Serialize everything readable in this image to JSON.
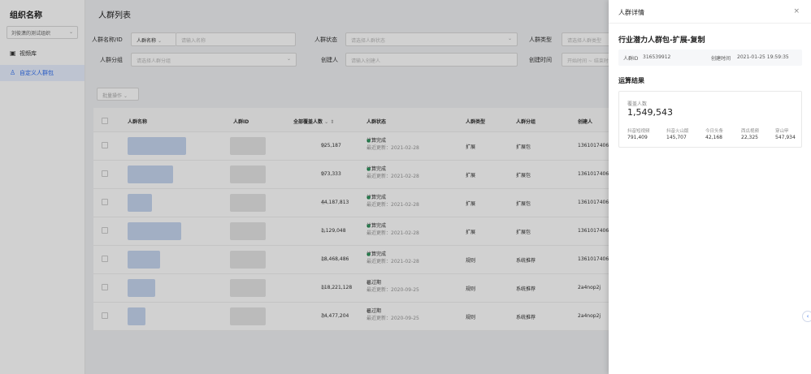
{
  "sidebar": {
    "org_title": "组织名称",
    "org_select": "刘俊潇的测试组织",
    "items": [
      {
        "label": "视频库",
        "icon": "video-library-icon"
      },
      {
        "label": "自定义人群包",
        "icon": "user-group-icon"
      }
    ]
  },
  "main": {
    "title": "人群列表",
    "filters": {
      "name_id_label": "人群名称/ID",
      "name_type": "人群名称",
      "name_placeholder": "请输入名称",
      "status_label": "人群状态",
      "status_placeholder": "请选择人群状态",
      "type_label": "人群类型",
      "type_placeholder": "请选择人群类型",
      "group_label": "人群分组",
      "group_placeholder": "请选择人群分组",
      "creator_label": "创建人",
      "creator_placeholder": "请输入创建人",
      "create_time_label": "创建时间",
      "create_time_placeholder": "开始时间 ~ 结束时间"
    },
    "batch_button": "批量操作",
    "table": {
      "headers": [
        "人群名称",
        "人群ID",
        "全部覆盖人数",
        "人群状态",
        "人群类型",
        "人群分组",
        "创建人"
      ],
      "rows": [
        {
          "cover": "925,187",
          "status": "计算完成",
          "updated": "最近更新：2021-02-28",
          "type": "扩展",
          "group": "扩展包",
          "creator": "13610174060",
          "finished": true
        },
        {
          "cover": "973,333",
          "status": "计算完成",
          "updated": "最近更新：2021-02-28",
          "type": "扩展",
          "group": "扩展包",
          "creator": "13610174060",
          "finished": true
        },
        {
          "cover": "44,187,813",
          "status": "计算完成",
          "updated": "最近更新：2021-02-28",
          "type": "扩展",
          "group": "扩展包",
          "creator": "13610174060",
          "finished": true
        },
        {
          "cover": "1,129,048",
          "status": "计算完成",
          "updated": "最近更新：2021-02-28",
          "type": "扩展",
          "group": "扩展包",
          "creator": "13610174060",
          "finished": true
        },
        {
          "cover": "18,468,486",
          "status": "计算完成",
          "updated": "最近更新：2021-02-28",
          "type": "规则",
          "group": "系统推荐",
          "creator": "13610174060",
          "finished": true
        },
        {
          "cover": "118,221,128",
          "status": "已过期",
          "updated": "最近更新：2020-09-25",
          "type": "规则",
          "group": "系统推荐",
          "creator": "2a4nop2j",
          "finished": false
        },
        {
          "cover": "34,477,204",
          "status": "已过期",
          "updated": "最近更新：2020-09-25",
          "type": "规则",
          "group": "系统推荐",
          "creator": "2a4nop2j",
          "finished": false
        }
      ]
    }
  },
  "drawer": {
    "title": "人群详情",
    "crowd_name": "行业潜力人群包-扩展-复制",
    "crowd_id_label": "人群ID",
    "crowd_id": "316539912",
    "create_time_label": "创建时间",
    "create_time": "2021-01-25 19:59:35",
    "result_title": "运算结果",
    "cover_label": "覆盖人数",
    "cover_value": "1,549,543",
    "stats": [
      {
        "label": "抖音短视频",
        "value": "791,409"
      },
      {
        "label": "抖音火山版",
        "value": "145,707"
      },
      {
        "label": "今日头条",
        "value": "42,168"
      },
      {
        "label": "西瓜视频",
        "value": "22,325"
      },
      {
        "label": "穿山甲",
        "value": "547,934"
      }
    ]
  }
}
